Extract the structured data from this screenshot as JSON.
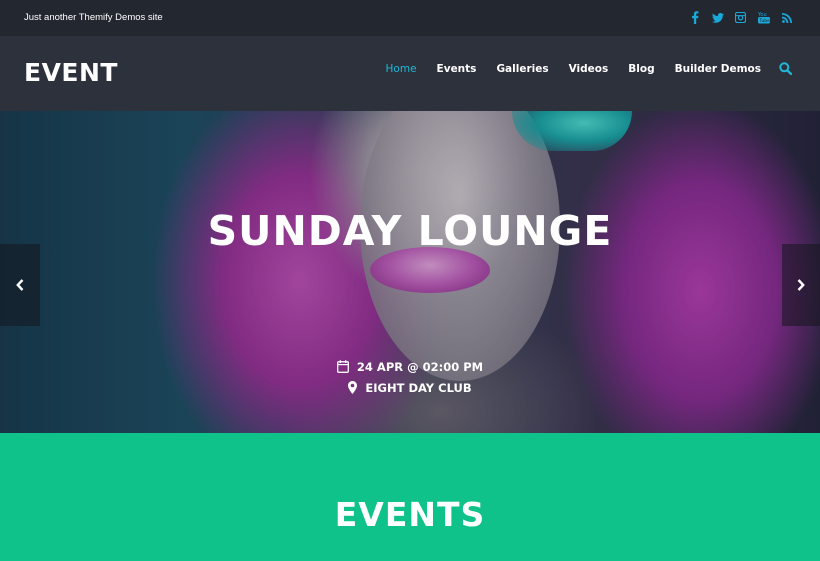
{
  "topbar": {
    "tagline": "Just another Themify Demos site",
    "social": [
      "facebook-icon",
      "twitter-icon",
      "instagram-icon",
      "youtube-icon",
      "rss-icon"
    ],
    "social_color": "#1aa8d9"
  },
  "header": {
    "logo": "EVENT",
    "nav": [
      {
        "label": "Home",
        "active": true
      },
      {
        "label": "Events",
        "active": false
      },
      {
        "label": "Galleries",
        "active": false
      },
      {
        "label": "Videos",
        "active": false
      },
      {
        "label": "Blog",
        "active": false
      },
      {
        "label": "Builder Demos",
        "active": false
      }
    ],
    "accent": "#1fb8d9"
  },
  "hero": {
    "title": "SUNDAY LOUNGE",
    "date": "24 APR @ 02:00 PM",
    "location": "EIGHT DAY CLUB"
  },
  "section": {
    "title": "EVENTS",
    "background": "#0fc28a"
  }
}
